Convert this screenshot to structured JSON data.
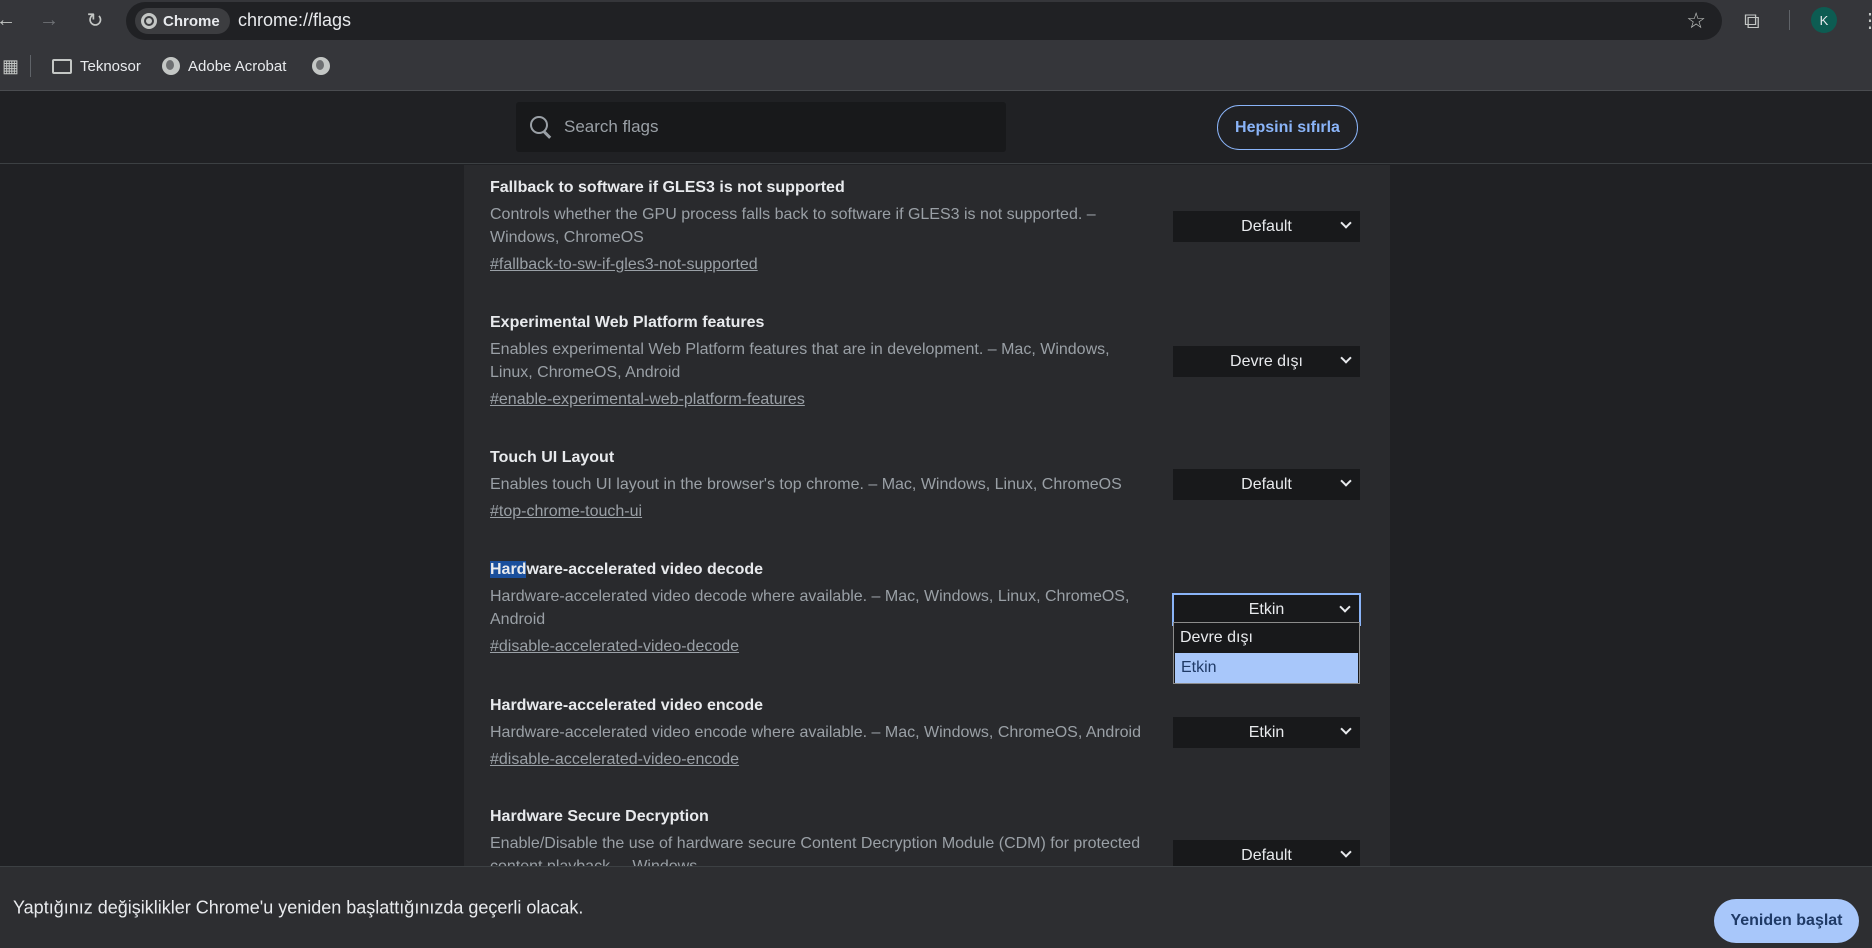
{
  "browser": {
    "omnibox_chip": "Chrome",
    "url": "chrome://flags",
    "avatar_letter": "K"
  },
  "bookmarks": [
    {
      "label": "Teknosor",
      "icon": "folder-icon"
    },
    {
      "label": "Adobe Acrobat",
      "icon": "globe-icon"
    },
    {
      "label": "",
      "icon": "globe-icon"
    }
  ],
  "header": {
    "search_placeholder": "Search flags",
    "reset_label": "Hepsini sıfırla"
  },
  "flags": [
    {
      "title": "Fallback to software if GLES3 is not supported",
      "description": "Controls whether the GPU process falls back to software if GLES3 is not supported. – Windows, ChromeOS",
      "link": "#fallback-to-sw-if-gles3-not-supported",
      "value": "Default"
    },
    {
      "title": "Experimental Web Platform features",
      "description": "Enables experimental Web Platform features that are in development. – Mac, Windows, Linux, ChromeOS, Android",
      "link": "#enable-experimental-web-platform-features",
      "value": "Devre dışı"
    },
    {
      "title": "Touch UI Layout",
      "description": "Enables touch UI layout in the browser's top chrome. – Mac, Windows, Linux, ChromeOS",
      "link": "#top-chrome-touch-ui",
      "value": "Default"
    },
    {
      "title_highlight": "Hard",
      "title_rest": "ware-accelerated video decode",
      "description": "Hardware-accelerated video decode where available. – Mac, Windows, Linux, ChromeOS, Android",
      "link": "#disable-accelerated-video-decode",
      "value": "Etkin"
    },
    {
      "title": "Hardware-accelerated video encode",
      "description": "Hardware-accelerated video encode where available. – Mac, Windows, ChromeOS, Android",
      "link": "#disable-accelerated-video-encode",
      "value": "Etkin"
    },
    {
      "title": "Hardware Secure Decryption",
      "description": "Enable/Disable the use of hardware secure Content Decryption Module (CDM) for protected content playback. – Windows",
      "value": "Default"
    }
  ],
  "dropdown": {
    "options": [
      "Devre dışı",
      "Etkin"
    ],
    "selected": "Etkin"
  },
  "restart": {
    "message": "Yaptığınız değişiklikler Chrome'u yeniden başlattığınızda geçerli olacak.",
    "button": "Yeniden başlat"
  },
  "colors": {
    "accent": "#8ab4f8",
    "selected_option": "#a8c7fa"
  }
}
